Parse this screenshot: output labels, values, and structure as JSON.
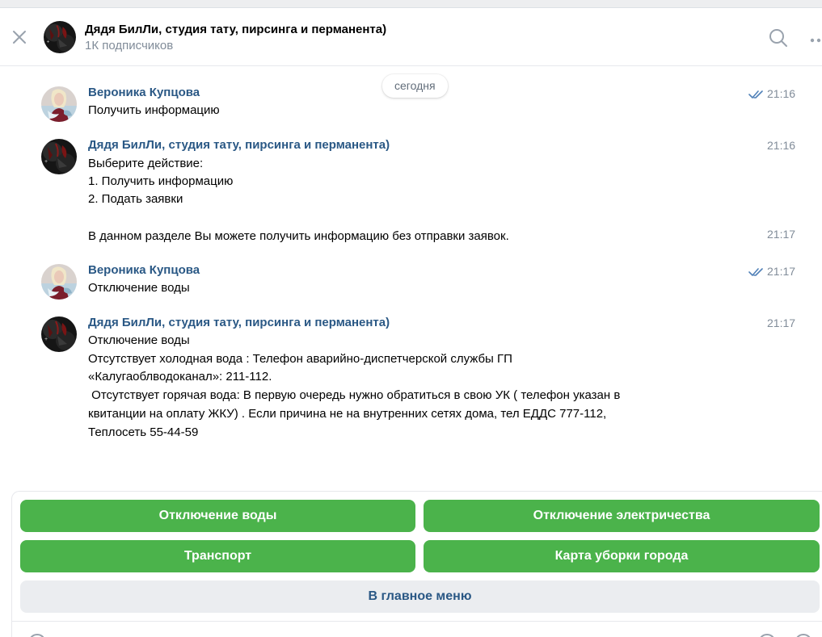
{
  "header": {
    "title": "Дядя БилЛи, студия тату, пирсинга и перманента)",
    "subtitle": "1К подписчиков"
  },
  "date_divider": "сегодня",
  "messages": [
    {
      "author": "Вероника Купцова",
      "time": "21:16",
      "read": true,
      "lines": [
        "Получить информацию"
      ]
    },
    {
      "author": "Дядя БилЛи, студия тату, пирсинга и перманента)",
      "time": "21:16",
      "lines": [
        "Выберите действие:",
        "1. Получить информацию",
        "2. Подать заявки"
      ],
      "followup": {
        "time": "21:17",
        "lines": [
          "В данном разделе Вы можете получить информацию без отправки заявок."
        ]
      }
    },
    {
      "author": "Вероника Купцова",
      "time": "21:17",
      "read": true,
      "lines": [
        "Отключение воды"
      ]
    },
    {
      "author": "Дядя БилЛи, студия тату, пирсинга и перманента)",
      "time": "21:17",
      "lines": [
        "Отключение воды",
        "Отсутствует холодная вода : Телефон аварийно-диспетчерской службы ГП",
        "«Калугаоблводоканал»:  211-112.",
        " Отсутствует горячая вода: В первую очередь нужно обратиться в свою УК ( телефон указан в",
        "квитанции на оплату ЖКУ) . Если причина не на внутренних сетях дома, тел ЕДДС 777-112,",
        "Теплосеть 55-44-59"
      ]
    }
  ],
  "keyboard": {
    "buttons": [
      {
        "label": "Отключение воды"
      },
      {
        "label": "Отключение электричества"
      },
      {
        "label": "Транспорт"
      },
      {
        "label": "Карта уборки города"
      },
      {
        "label": "В главное меню"
      }
    ]
  },
  "icons": {
    "close": "close-icon",
    "search": "search-icon",
    "more": "more-icon",
    "read_receipt": "double-check-icon"
  },
  "colors": {
    "link": "#2a5885",
    "button_green": "#4bb34b",
    "button_gray": "#ebedf0",
    "muted": "#818c99"
  }
}
